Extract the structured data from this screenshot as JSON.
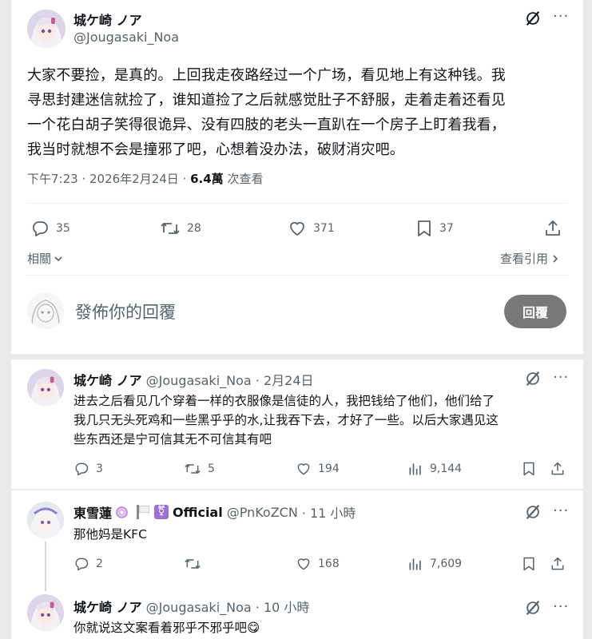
{
  "main_post": {
    "author_name": "城ケ崎 ノア",
    "author_handle": "@Jougasaki_Noa",
    "body_lines": [
      "大家不要捡，是真的。上回我走夜路经过一个广场，看见地上有这种钱。我",
      "寻思封建迷信就捡了，谁知道捡了之后就感觉肚子不舒服，走着走着还看见",
      "一个花白胡子笑得很诡异、没有四肢的老头一直趴在一个房子上盯着我看，",
      "我当时就想不会是撞邪了吧，心想着没办法，破财消灾吧。"
    ],
    "timestamp": "下午7:23 · 2026年2月24日 · ",
    "views_count": "6.4萬",
    "views_label": " 次查看",
    "stats": {
      "replies": "35",
      "retweets": "28",
      "likes": "371",
      "bookmarks": "37"
    },
    "related_label": "相關",
    "view_quotes_label": "查看引用",
    "reply_placeholder": "發佈你的回覆",
    "reply_button": "回覆"
  },
  "replies": [
    {
      "author_name": "城ケ崎 ノア",
      "author_handle": "@Jougasaki_Noa",
      "time": "· 2月24日",
      "body_lines": [
        "进去之后看见几个穿着一样的衣服像是信徒的人，我把钱给了他们，他们给了",
        "我几只无头死鸡和一些黑乎乎的水,让我吞下去，才好了一些。以后大家遇见这",
        "些东西还是宁可信其无不可信其有吧"
      ],
      "stats": {
        "replies": "3",
        "retweets": "5",
        "likes": "194",
        "views": "9,144"
      }
    },
    {
      "author_name": "東雪蓮",
      "badge_label": "Official",
      "author_handle": "@PnKoZCN",
      "time": "· 11 小時",
      "body_lines": [
        "那他妈是KFC"
      ],
      "stats": {
        "replies": "2",
        "retweets": "",
        "likes": "168",
        "views": "7,609"
      }
    },
    {
      "author_name": "城ケ崎 ノア",
      "author_handle": "@Jougasaki_Noa",
      "time": "· 10 小時",
      "body_lines": [
        "你就说这文案看着邪乎不邪乎吧😋"
      ]
    }
  ],
  "colors": {
    "text": "#0f1419",
    "muted": "#536471",
    "reply_button": "#787878",
    "divider": "#eff3f4"
  },
  "icons": [
    "grok-icon",
    "more-icon",
    "reply-icon",
    "retweet-icon",
    "like-icon",
    "bookmark-icon",
    "share-icon",
    "views-icon",
    "chevron-down-icon",
    "chevron-right-icon"
  ]
}
